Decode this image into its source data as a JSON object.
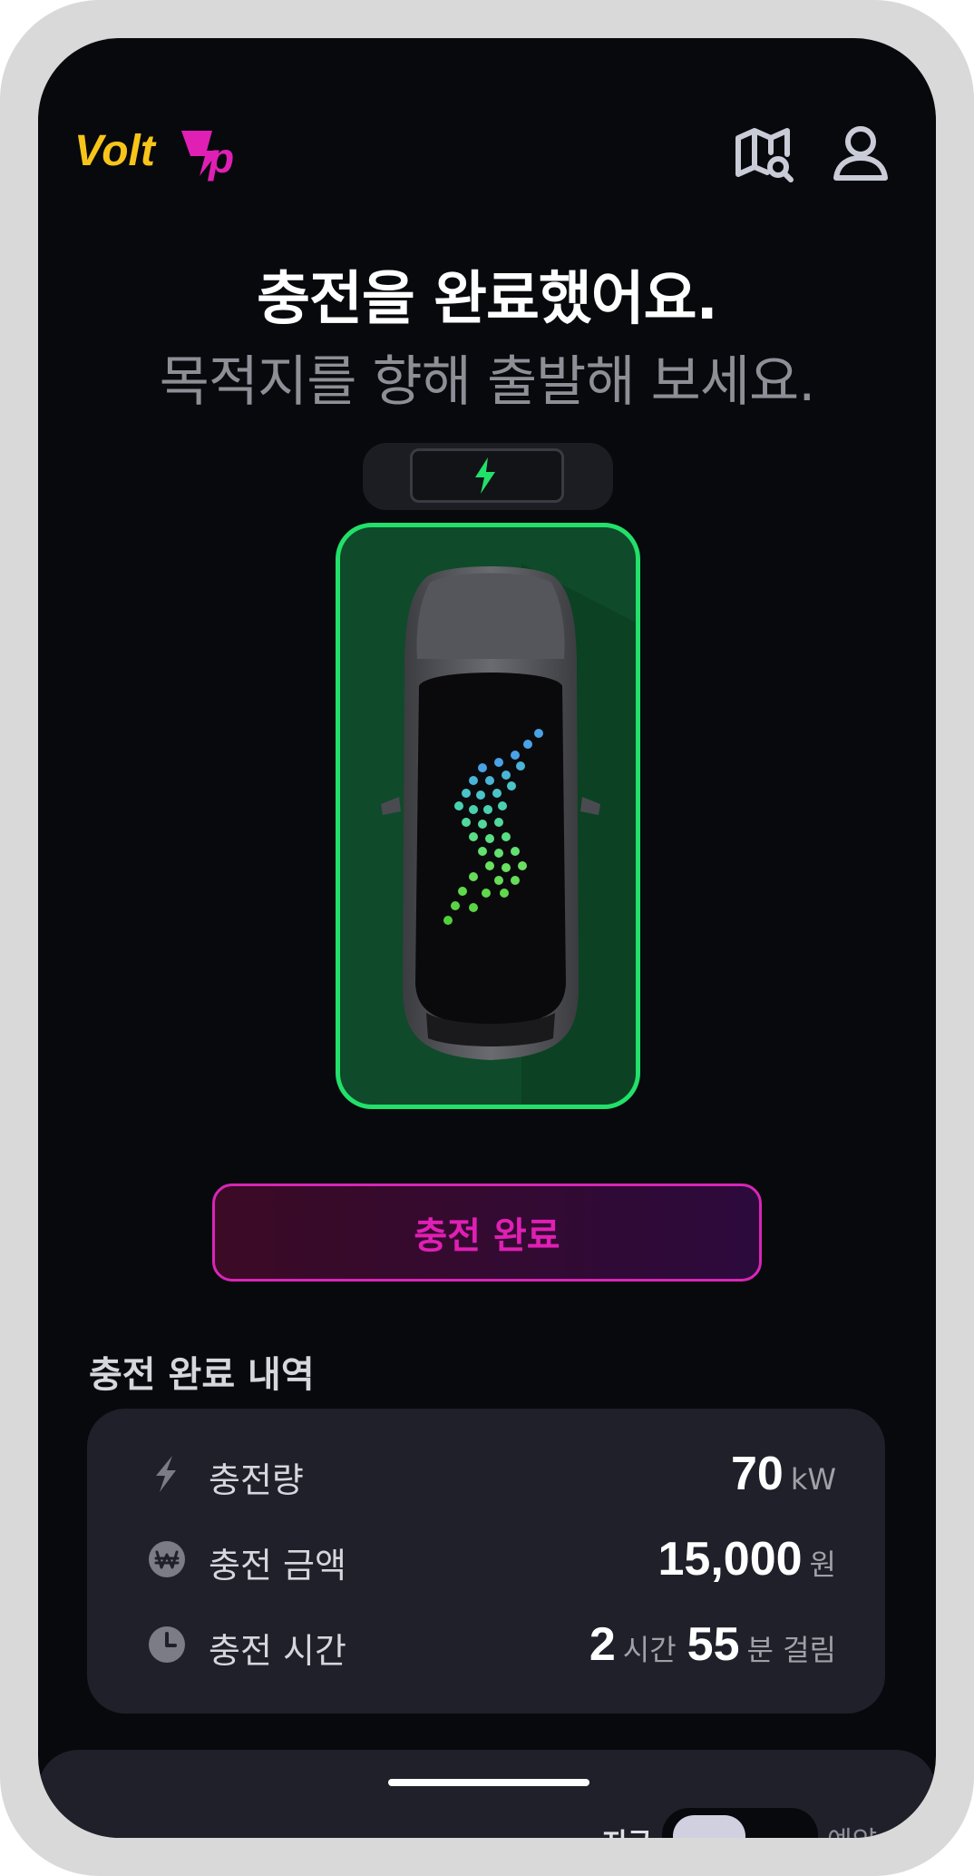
{
  "app": {
    "brand": "VoltUp"
  },
  "header": {
    "map_icon": "map-search-icon",
    "profile_icon": "user-icon"
  },
  "hero": {
    "title": "충전을 완료했어요.",
    "subtitle": "목적지를 향해 출발해 보세요."
  },
  "status_button": {
    "label": "충전 완료"
  },
  "history": {
    "title": "충전 완료 내역",
    "rows": [
      {
        "icon": "bolt-icon",
        "label": "충전량",
        "value": "70",
        "unit": "kW"
      },
      {
        "icon": "won-icon",
        "label": "충전 금액",
        "value": "15,000",
        "unit": "원"
      },
      {
        "icon": "clock-icon",
        "label": "충전 시간",
        "hours": "2",
        "hours_unit": "시간",
        "minutes": "55",
        "minutes_unit": "분 걸림"
      }
    ]
  },
  "bottom_sheet": {
    "toggle_left": "지금",
    "toggle_right": "예약"
  },
  "colors": {
    "accent_green": "#22e06a",
    "accent_magenta": "#e01fb4",
    "brand_yellow": "#f7c51a",
    "brand_pink": "#e01fb4"
  }
}
